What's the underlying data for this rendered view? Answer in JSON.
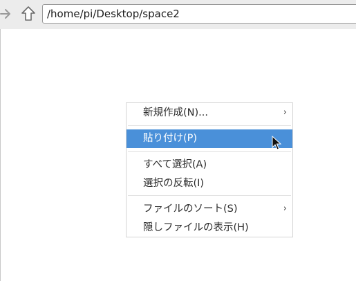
{
  "toolbar": {
    "address": "/home/pi/Desktop/space2"
  },
  "icons": {
    "forward": "arrow-right-icon",
    "up": "arrow-up-icon",
    "submenu": "chevron-right-icon",
    "cursor": "mouse-pointer-icon"
  },
  "colors": {
    "highlight": "#4a90d9"
  },
  "context_menu": {
    "items": [
      {
        "label": "新規作成(N)...",
        "submenu_glyph": "›"
      },
      {
        "label": "貼り付け(P)"
      },
      {
        "label": "すべて選択(A)"
      },
      {
        "label": "選択の反転(I)"
      },
      {
        "label": "ファイルのソート(S)",
        "submenu_glyph": "›"
      },
      {
        "label": "隠しファイルの表示(H)"
      }
    ]
  }
}
